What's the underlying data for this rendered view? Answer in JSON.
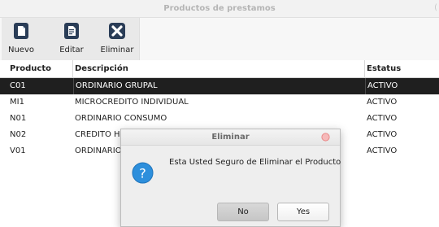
{
  "window": {
    "title": "Productos de prestamos"
  },
  "toolbar": {
    "buttons": [
      {
        "label": "Nuevo",
        "icon": "new-document-icon"
      },
      {
        "label": "Editar",
        "icon": "edit-document-icon"
      },
      {
        "label": "Eliminar",
        "icon": "delete-x-icon"
      }
    ]
  },
  "table": {
    "columns": [
      "Producto",
      "Descripción",
      "Estatus"
    ],
    "rows": [
      {
        "producto": "C01",
        "descripcion": "ORDINARIO GRUPAL",
        "estatus": "ACTIVO",
        "selected": true
      },
      {
        "producto": "MI1",
        "descripcion": "MICROCREDITO INDIVIDUAL",
        "estatus": "ACTIVO",
        "selected": false
      },
      {
        "producto": "N01",
        "descripcion": "ORDINARIO CONSUMO",
        "estatus": "ACTIVO",
        "selected": false
      },
      {
        "producto": "N02",
        "descripcion": "CREDITO HIPOTECARIO",
        "estatus": "ACTIVO",
        "selected": false
      },
      {
        "producto": "V01",
        "descripcion": "ORDINARIO",
        "estatus": "ACTIVO",
        "selected": false
      }
    ]
  },
  "dialog": {
    "title": "Eliminar",
    "message": "Esta Usted Seguro de Eliminar el Producto",
    "no_label": "No",
    "yes_label": "Yes",
    "icon": "question-icon"
  },
  "colors": {
    "selection": "#1f1f1f",
    "question_icon": "#2d8fdc",
    "toolbar_icon": "#2a3d57",
    "close_button": "#f08080"
  }
}
